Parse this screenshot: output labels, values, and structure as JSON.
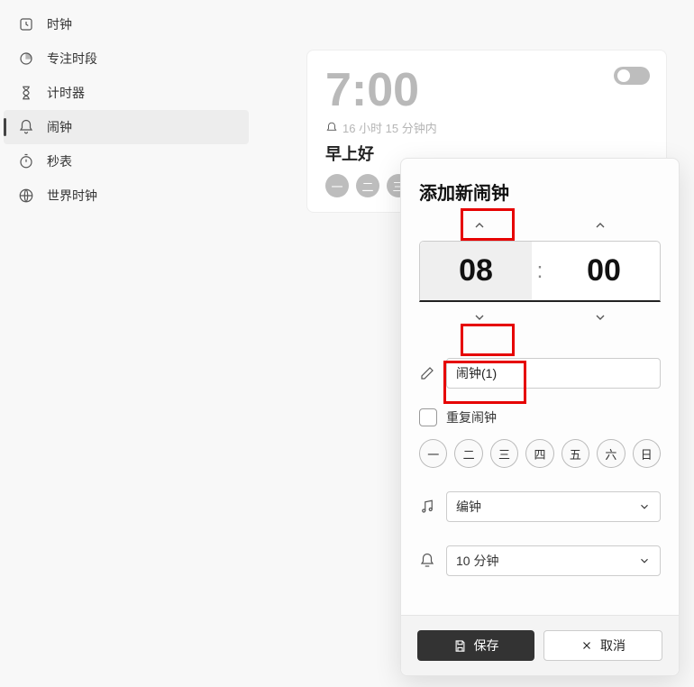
{
  "sidebar": {
    "items": [
      {
        "label": "时钟"
      },
      {
        "label": "专注时段"
      },
      {
        "label": "计时器"
      },
      {
        "label": "闹钟"
      },
      {
        "label": "秒表"
      },
      {
        "label": "世界时钟"
      }
    ]
  },
  "alarm_card": {
    "time": "7:00",
    "remaining": "16 小时 15 分钟内",
    "label": "早上好",
    "days": [
      "一",
      "二",
      "三"
    ]
  },
  "dialog": {
    "title": "添加新闹钟",
    "hour": "08",
    "minute": "00",
    "name_value": "闹钟(1)",
    "repeat_label": "重复闹钟",
    "weekdays": [
      "一",
      "二",
      "三",
      "四",
      "五",
      "六",
      "日"
    ],
    "sound_value": "编钟",
    "snooze_value": "10 分钟",
    "save_label": "保存",
    "cancel_label": "取消"
  }
}
